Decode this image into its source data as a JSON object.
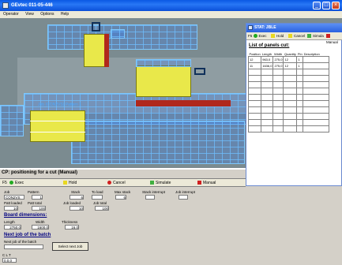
{
  "window": {
    "title": "GEvtec 011-05-446"
  },
  "menu": [
    "Operator",
    "View",
    "Options",
    "Help"
  ],
  "machine": {
    "pattern_label": "Job (CON2VS)   Pattern 1"
  },
  "stat": {
    "title": "STAT: JBLE",
    "toolbar": [
      {
        "icon": "F5",
        "label": "Exec"
      },
      {
        "icon": "yellow-square-icon",
        "label": "Hold"
      },
      {
        "icon": "yellow-square-icon",
        "label": "Cancel"
      },
      {
        "icon": "simulate-icon",
        "label": "Simula"
      },
      {
        "icon": "manual-icon",
        "label": "Manual"
      }
    ],
    "heading": "List of panels cut:",
    "columns": [
      "Position",
      "Length",
      "Width",
      "Quantity",
      "Pin",
      "Description"
    ],
    "rows": [
      [
        "12",
        "963,0",
        "275,0",
        "12",
        "1",
        ""
      ],
      [
        "11",
        "1636,0",
        "275,0",
        "12",
        "1",
        ""
      ]
    ]
  },
  "cp": {
    "title": "CP: positioning for a cut (Manual)",
    "toolbar": {
      "f5": "F5",
      "exec": "Exec",
      "hold": "Hold",
      "cancel": "Cancel",
      "simulate": "Simulate",
      "manual": "Manual"
    },
    "colors": {
      "exec": "#22aa22",
      "hold": "#e8d820",
      "cancel": "#d02020",
      "simulate": "#40b040",
      "manual": "#d02020"
    },
    "labels": {
      "job": "Job",
      "pattern": "Pattern",
      "stack": "Stack",
      "to_load": "To load",
      "max_stack": "Max stack",
      "stack_interrupt": "Stack interrupt",
      "job_interrupt": "Job interrupt",
      "patt_loaded": "Patt loaded",
      "patt_total": "Patt total",
      "job_loaded": "Job loaded",
      "job_total": "Job total",
      "board_dimensions": "Board dimensions:",
      "length": "Length",
      "width": "Width",
      "thickness": "Thickness",
      "next_job": "Next job of the batch",
      "next_job_field": "Next job of the batch"
    },
    "values": {
      "job": "CON2VS",
      "pattern": "1",
      "stack": "6",
      "to_load": "",
      "max_stack": "6",
      "stack_interrupt": "",
      "job_interrupt": "",
      "patt_loaded": "10",
      "patt_total": "100",
      "job_loaded": "10",
      "job_total": "100",
      "length": "2750,0",
      "width": "1600,0",
      "thickness": "16,0",
      "next_job": ""
    },
    "select_next_job_button": "Select next Job",
    "clt_label": "C L T",
    "clt_value": "0.0.0"
  }
}
